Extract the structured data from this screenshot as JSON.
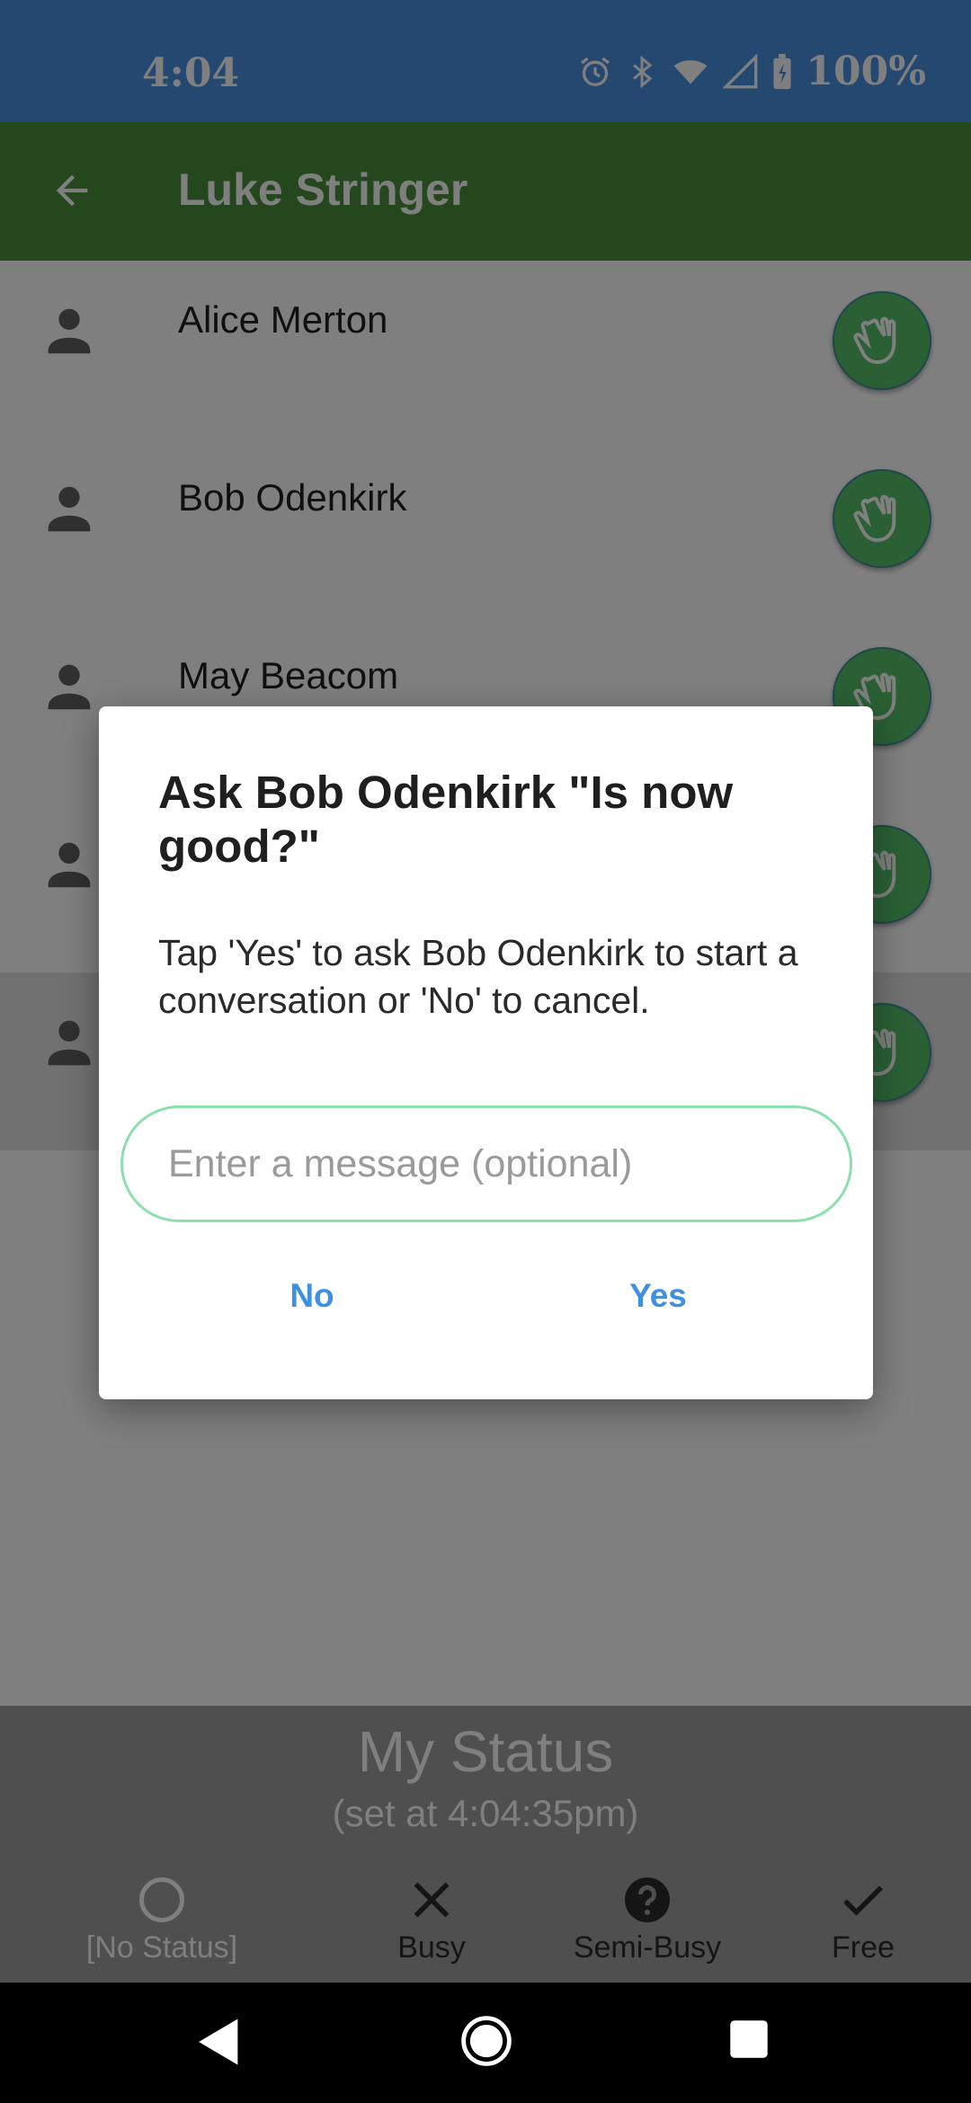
{
  "status_bar": {
    "time": "4:04",
    "battery": "100%"
  },
  "app_bar": {
    "title": "Luke Stringer"
  },
  "contacts": [
    {
      "name": "Alice Merton"
    },
    {
      "name": "Bob Odenkirk"
    },
    {
      "name": "May Beacom"
    },
    {
      "name": ""
    },
    {
      "name": ""
    }
  ],
  "my_status": {
    "title": "My Status",
    "subtitle": "(set at 4:04:35pm)"
  },
  "status_options": [
    {
      "label": "[No Status]",
      "icon": "circle-outline-icon"
    },
    {
      "label": "Busy",
      "icon": "close-icon"
    },
    {
      "label": "Semi-Busy",
      "icon": "help-circle-icon"
    },
    {
      "label": "Free",
      "icon": "check-icon"
    }
  ],
  "dialog": {
    "title": "Ask Bob Odenkirk \"Is now good?\"",
    "body": "Tap 'Yes' to ask Bob Odenkirk to start a conversation or 'No' to cancel.",
    "input_placeholder": "Enter a message (optional)",
    "input_value": "",
    "no_label": "No",
    "yes_label": "Yes"
  },
  "colors": {
    "status_bar": "#4a90e2",
    "app_bar": "#4a8f3c",
    "wave_button": "#55c169",
    "dialog_button_text": "#3f90e0",
    "input_border": "#8be0ac"
  }
}
